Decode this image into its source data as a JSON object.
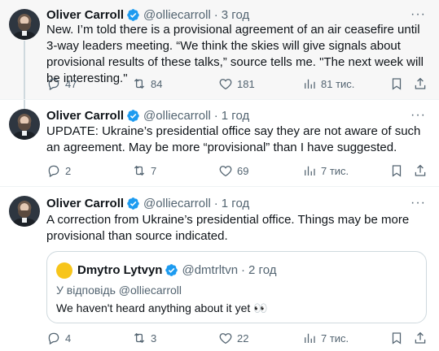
{
  "colors": {
    "verified": "#1d9bf0",
    "muted": "#536471",
    "text": "#0f1419",
    "quote_avatar": "#f7c51b"
  },
  "tweets": [
    {
      "name": "Oliver Carroll",
      "handle": "@olliecarroll",
      "time": "3 год",
      "text": "New. I’m told there is a provisional agreement of an air ceasefire until 3-way leaders meeting. “We think the skies will give signals about provisional results of these talks,” source tells me. \"The next week will be interesting.\"",
      "replies": "47",
      "reposts": "84",
      "likes": "181",
      "views": "81 тис."
    },
    {
      "name": "Oliver Carroll",
      "handle": "@olliecarroll",
      "time": "1 год",
      "text": "UPDATE: Ukraine’s presidential office say they are not aware of such an agreement. May be more “provisional” than I have suggested.",
      "replies": "2",
      "reposts": "7",
      "likes": "69",
      "views": "7 тис."
    },
    {
      "name": "Oliver Carroll",
      "handle": "@olliecarroll",
      "time": "1 год",
      "text": "A correction from Ukraine’s presidential office. Things may be more provisional than source indicated.",
      "replies": "4",
      "reposts": "3",
      "likes": "22",
      "views": "7 тис.",
      "quote": {
        "name": "Dmytro Lytvyn",
        "handle": "@dmtrltvn",
        "time": "2 год",
        "reply_to": "У відповідь @olliecarroll",
        "text": "We haven't heard anything about it yet 👀"
      }
    }
  ],
  "more_label": "···",
  "dot": "·",
  "icons": [
    "reply-icon",
    "repost-icon",
    "like-icon",
    "views-icon",
    "bookmark-icon",
    "share-icon",
    "verified-badge-icon",
    "more-icon"
  ]
}
